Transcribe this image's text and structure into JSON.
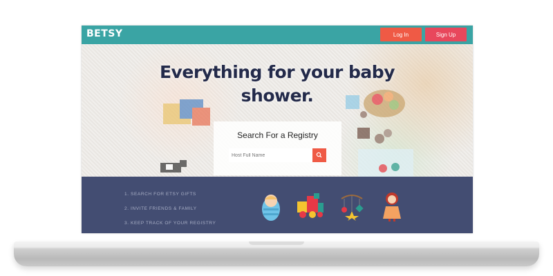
{
  "navbar": {
    "logo": "BETSY",
    "login_label": "Log In",
    "signup_label": "Sign Up"
  },
  "hero": {
    "title": "Everything for your baby shower."
  },
  "search": {
    "title": "Search For a Registry",
    "placeholder": "Host Full Name"
  },
  "steps": [
    "1. SEARCH FOR ETSY GIFTS",
    "2. INVITE FRIENDS & FAMILY",
    "3. KEEP TRACK OF YOUR REGISTRY"
  ],
  "icons": [
    "baby-icon",
    "toy-train-icon",
    "baby-mobile-icon",
    "doll-icon"
  ],
  "colors": {
    "nav": "#3aa4a4",
    "login": "#ef5a45",
    "signup": "#e8475c",
    "footer": "#434d72",
    "title": "#232a4a"
  }
}
